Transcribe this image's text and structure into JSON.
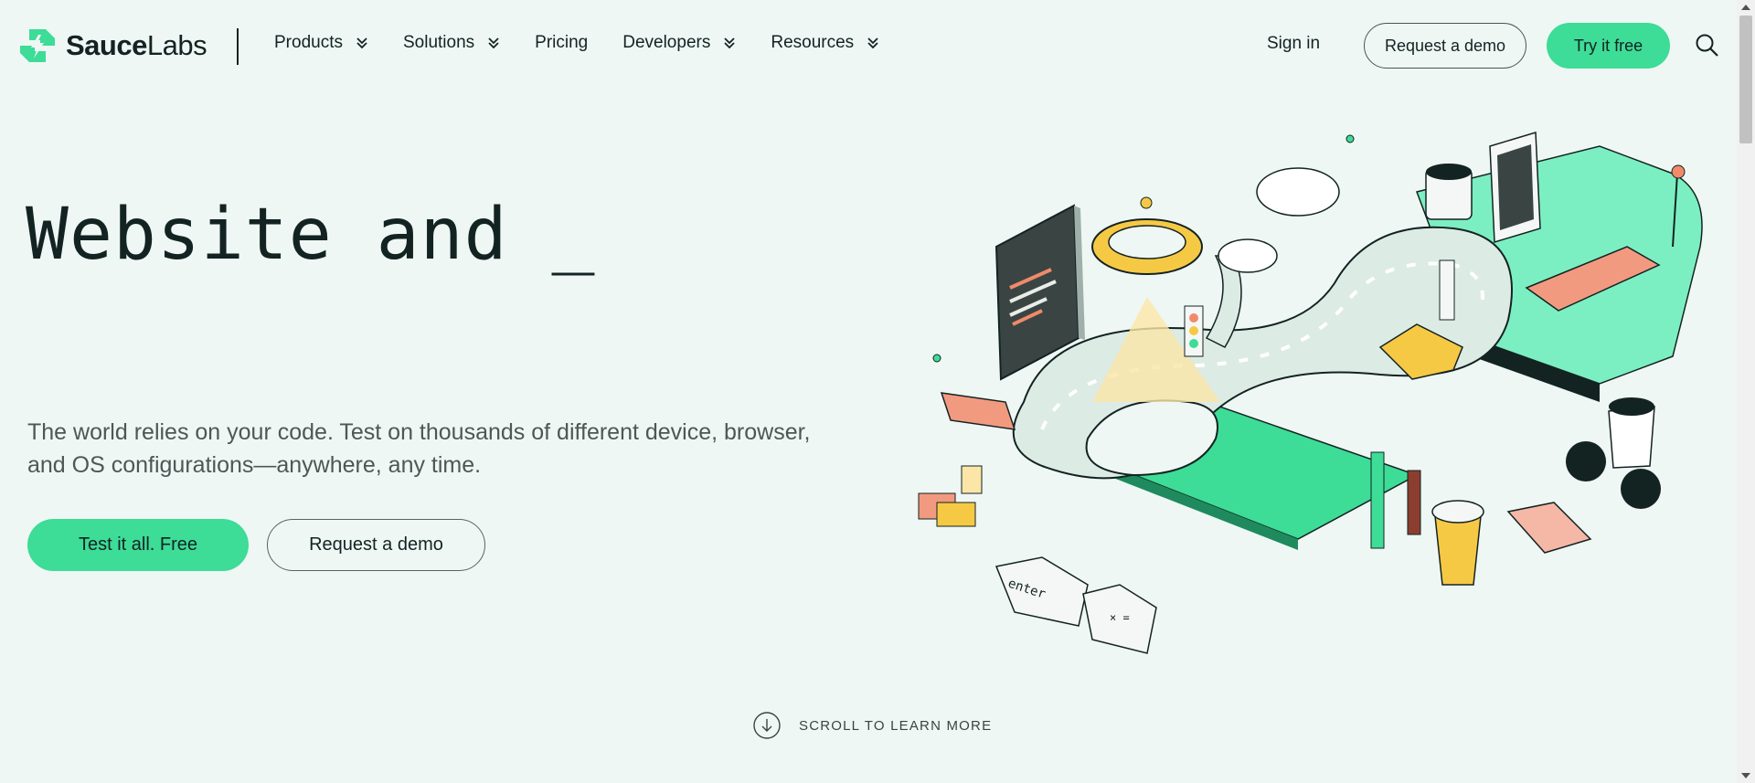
{
  "header": {
    "logo_text_bold": "Sauce",
    "logo_text_light": "Labs",
    "nav": [
      {
        "label": "Products",
        "has_dropdown": true
      },
      {
        "label": "Solutions",
        "has_dropdown": true
      },
      {
        "label": "Pricing",
        "has_dropdown": false
      },
      {
        "label": "Developers",
        "has_dropdown": true
      },
      {
        "label": "Resources",
        "has_dropdown": true
      }
    ],
    "sign_in": "Sign in",
    "request_demo": "Request a demo",
    "try_free": "Try it free"
  },
  "hero": {
    "headline": "Website and _",
    "subtext": "The world relies on your code. Test on thousands of different device, browser, and OS configurations—anywhere, any time.",
    "primary_cta": "Test it all. Free",
    "secondary_cta": "Request a demo",
    "scroll_hint": "SCROLL TO LEARN MORE",
    "illustration_keys": {
      "enter": "enter",
      "symbols": "× ="
    }
  },
  "colors": {
    "brand_green": "#3ddc97",
    "background": "#eef7f4",
    "text": "#132322"
  },
  "icons": [
    "saucelabs-logo-icon",
    "chevron-double-down-icon",
    "search-icon",
    "arrow-down-circle-icon"
  ]
}
